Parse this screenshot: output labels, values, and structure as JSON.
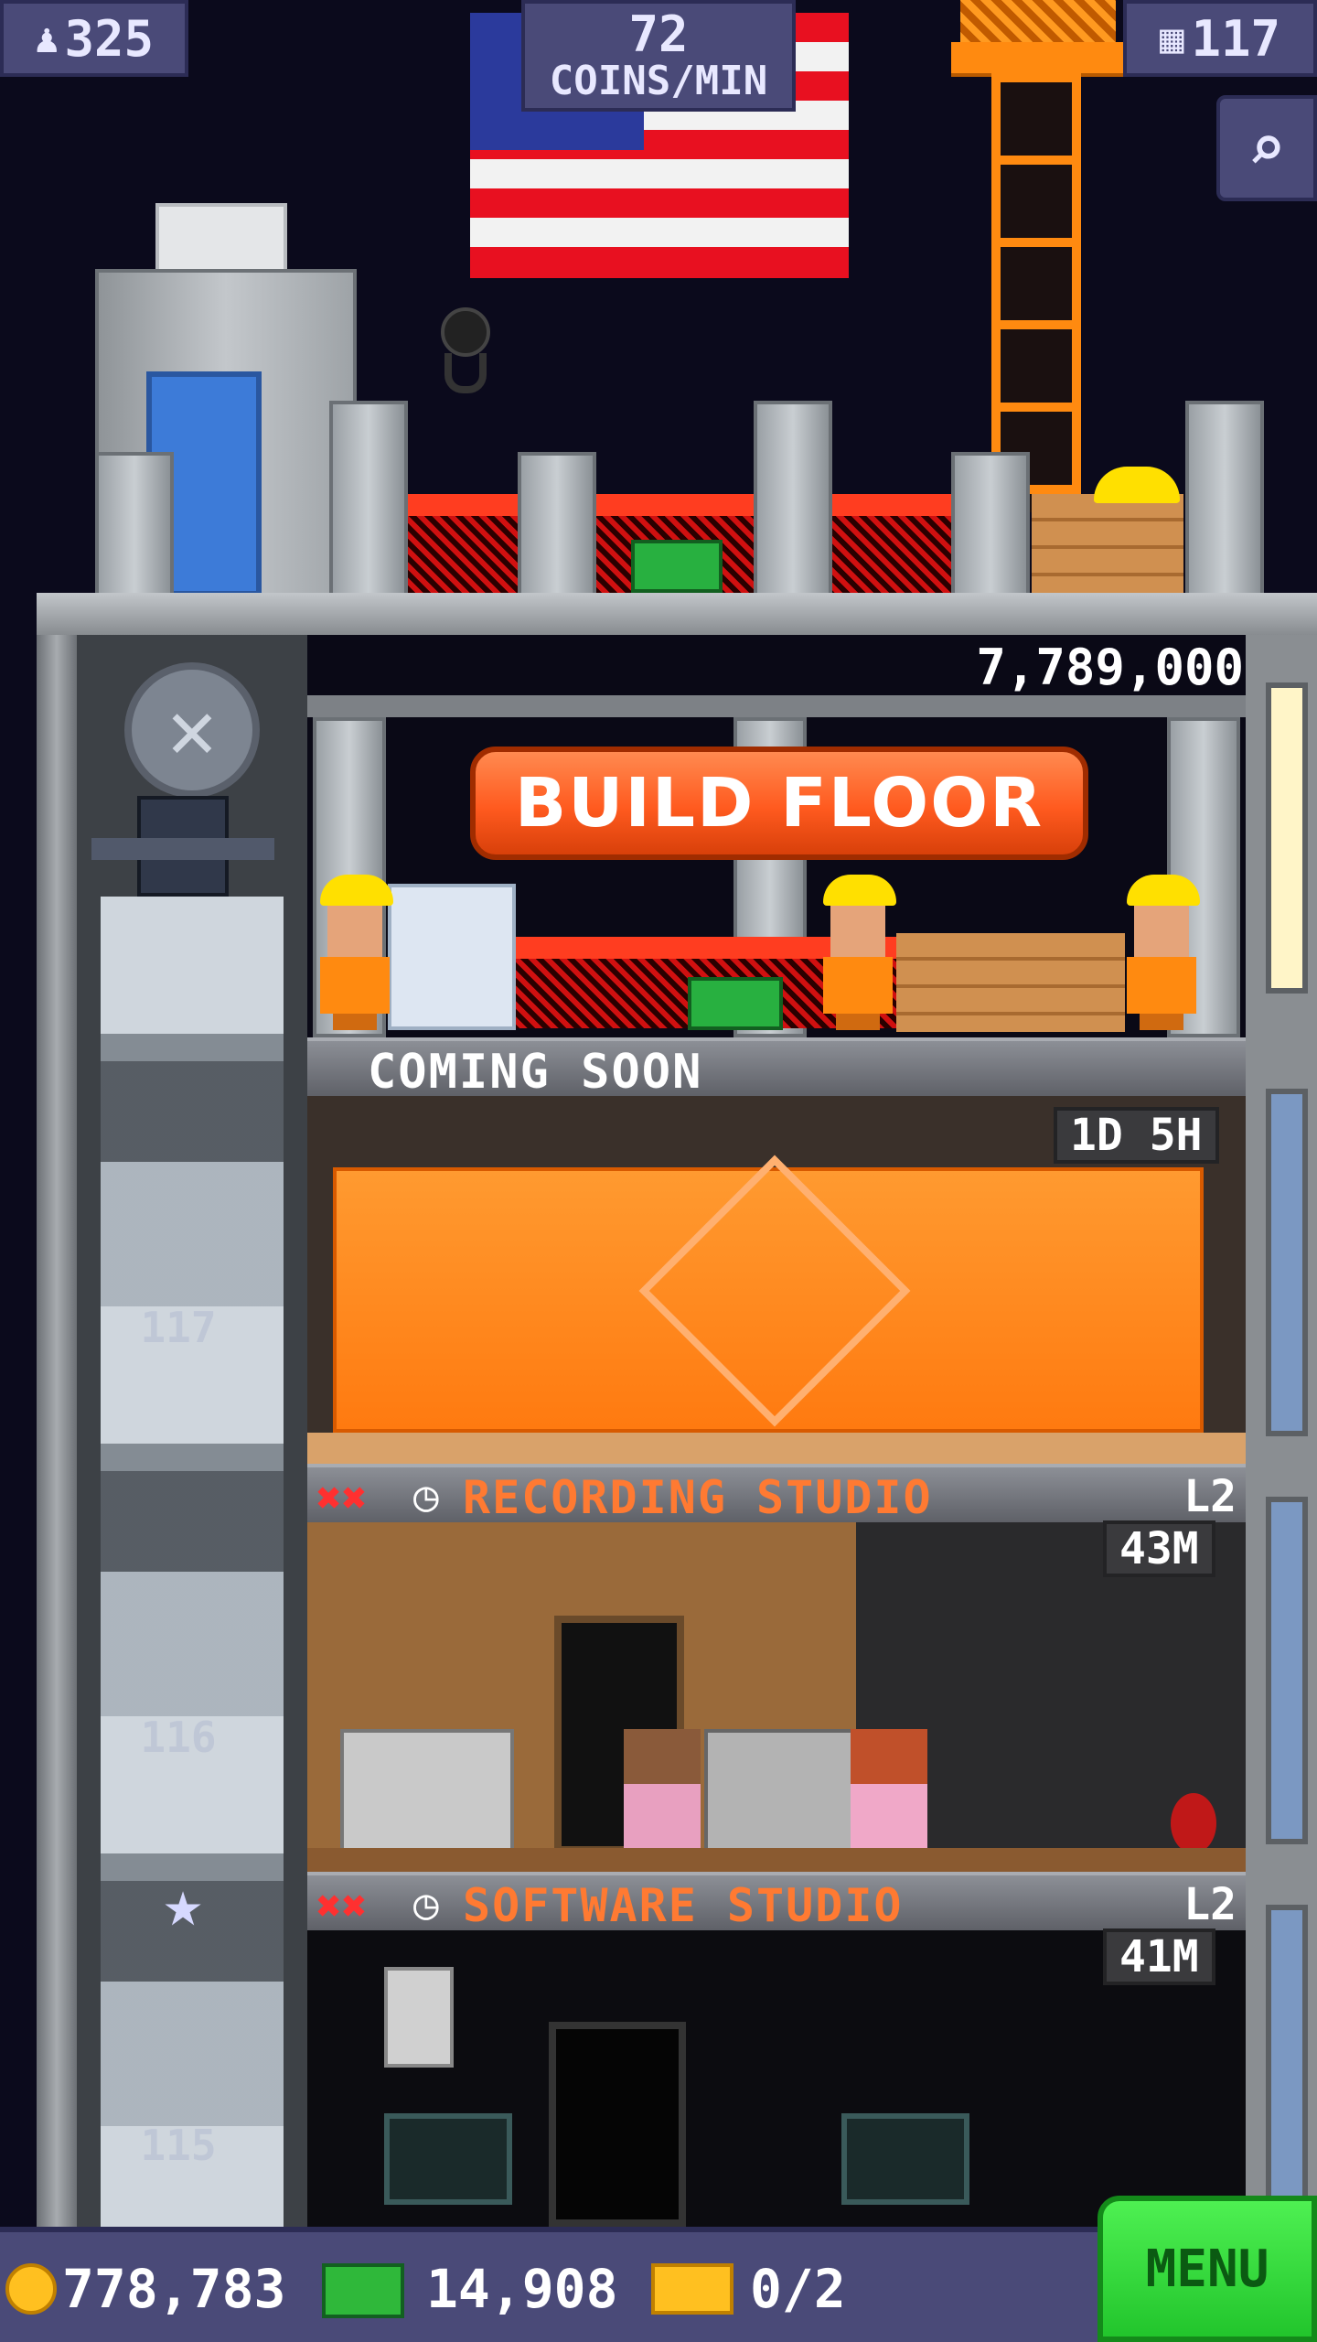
{
  "hud": {
    "population": "325",
    "rate_value": "72",
    "rate_unit": "COINS/MIN",
    "floors": "117"
  },
  "tower": {
    "build_cost": "7,789,000",
    "build_label": "BUILD FLOOR",
    "coming_soon": "COMING SOON",
    "construction_timer": "1D 5H",
    "floors": [
      {
        "name": "RECORDING STUDIO",
        "level": "L2",
        "timer": "43M"
      },
      {
        "name": "SOFTWARE STUDIO",
        "level": "L2",
        "timer": "41M"
      }
    ],
    "floor_numbers": [
      "117",
      "116",
      "115"
    ]
  },
  "bottom": {
    "coins": "778,783",
    "bux": "14,908",
    "tickets": "0/2",
    "menu_label": "MENU"
  },
  "colors": {
    "orange": "#ff5a1f",
    "menu_green": "#2fd93a",
    "hud_bg": "#4a4a78"
  }
}
